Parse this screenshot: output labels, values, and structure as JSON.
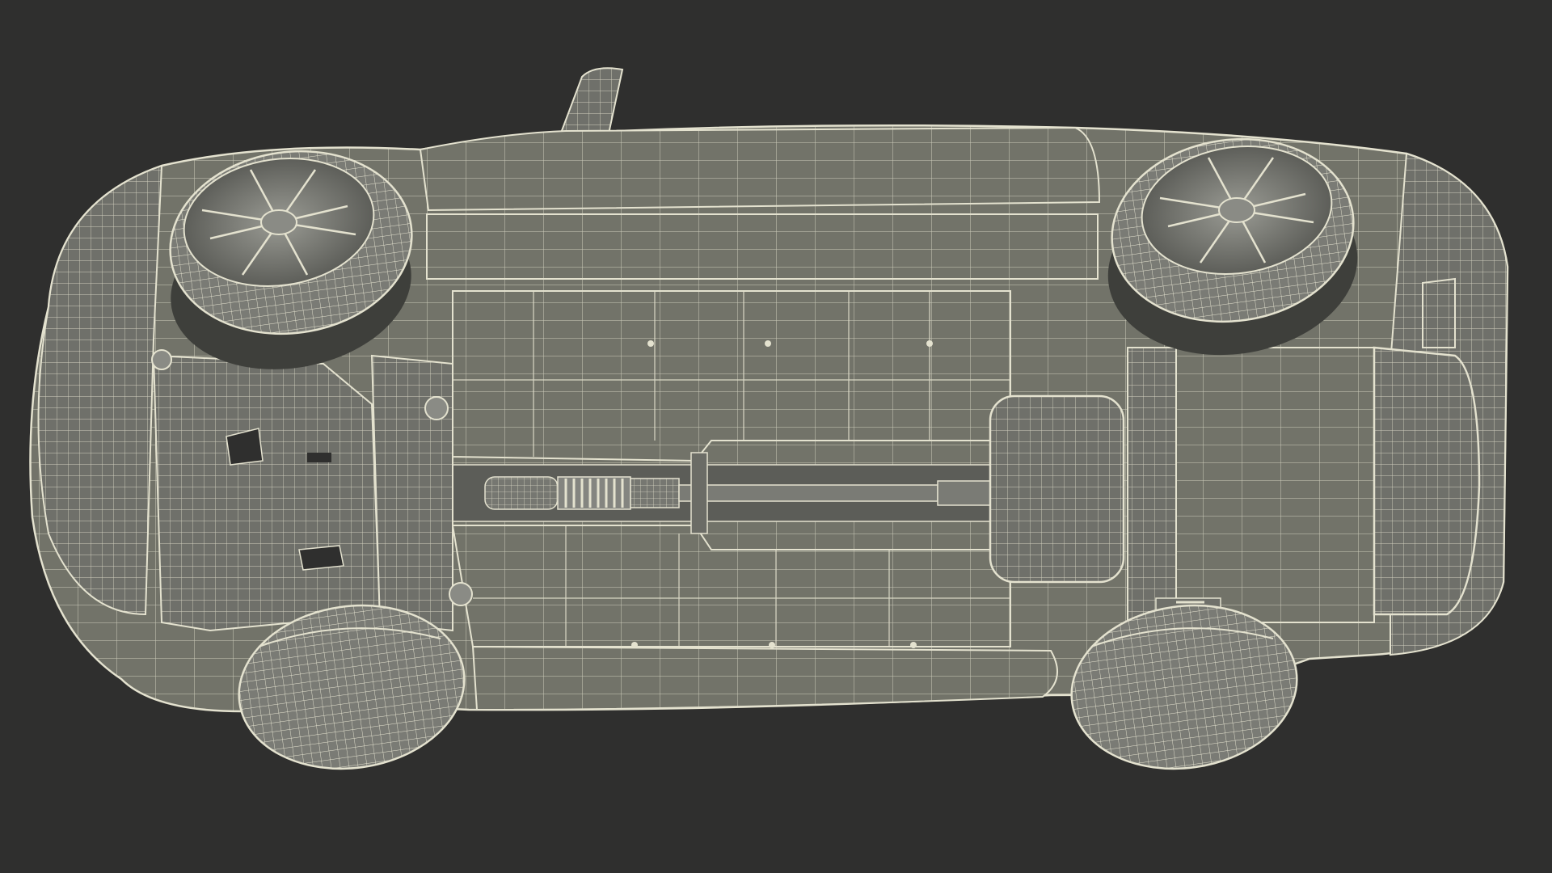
{
  "scene": {
    "subject": "car-underside-wireframe",
    "colors": {
      "background": "#2f2f2e",
      "surface": "#6f706a",
      "surface_light": "#8a8b85",
      "surface_dark": "#4f504b",
      "wire": "#e4e2cf",
      "shadow": "#3e3f3b"
    },
    "parts": [
      "front-left-wheel",
      "front-right-wheel",
      "rear-left-wheel",
      "rear-right-wheel",
      "floor-pan",
      "exhaust-system",
      "fuel-tank",
      "rear-muffler",
      "front-subframe",
      "side-mirror"
    ]
  }
}
